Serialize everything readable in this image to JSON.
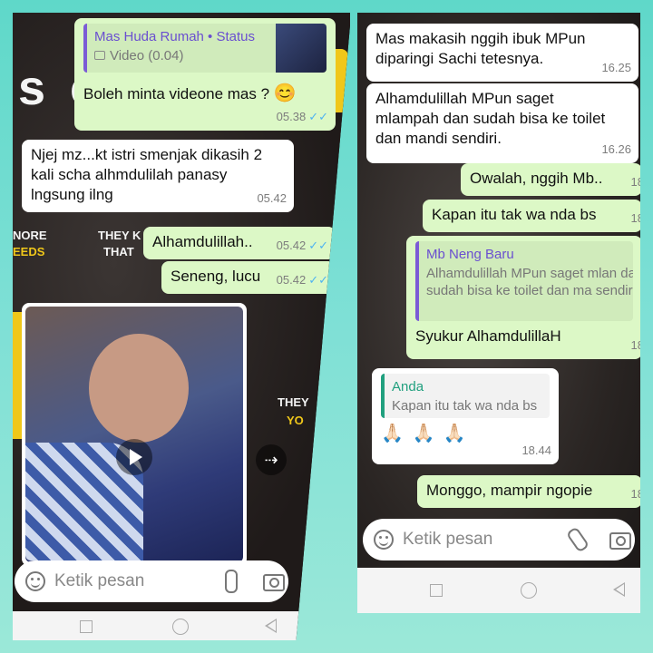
{
  "left": {
    "bg_text": {
      "top_big": "s c",
      "more": "NORE",
      "needs": "EEDS",
      "they1": "THEY K",
      "that": "THAT",
      "they2": "THEY",
      "you": "YO"
    },
    "msg1": {
      "reply_name": "Mas Huda Rumah • Status",
      "reply_text": "Video (0.04)",
      "text": "Boleh minta videone mas  ?",
      "emoji": "😊",
      "time": "05.38"
    },
    "msg2": {
      "text": "Njej mz...kt istri smenjak dikasih 2 kali scha alhmdulilah panasy lngsung ilng",
      "time": "05.42"
    },
    "msg3": {
      "text": "Alhamdulillah..",
      "time": "05.42"
    },
    "msg4": {
      "text": "Seneng, lucu",
      "time": "05.42"
    },
    "composer": {
      "placeholder": "Ketik pesan"
    }
  },
  "right": {
    "msg1": {
      "text": "Mas makasih nggih ibuk MPun diparingi Sachi tetesnya.",
      "time": "16.25"
    },
    "msg2": {
      "text": "Alhamdulillah MPun saget mlampah dan sudah bisa ke toilet dan mandi sendiri.",
      "time": "16.26"
    },
    "msg3": {
      "text": "Owalah, nggih Mb..",
      "time": "18"
    },
    "msg4": {
      "text": "Kapan itu tak wa nda bs",
      "time": "18"
    },
    "msg5": {
      "reply_name": "Mb Neng Baru",
      "reply_text": "Alhamdulillah MPun saget mlan dan sudah bisa ke toilet dan ma sendiri.",
      "text": "Syukur AlhamdulillaH",
      "time": "18"
    },
    "msg6": {
      "reply_name": "Anda",
      "reply_text": "Kapan itu tak wa nda bs",
      "emojis": "🙏🏻 🙏🏻 🙏🏻",
      "time": "18.44"
    },
    "msg7": {
      "text": "Monggo, mampir ngopie",
      "time": "18"
    },
    "composer": {
      "placeholder": "Ketik pesan"
    }
  },
  "colors": {
    "outgoing": "#dcf8c6",
    "incoming": "#ffffff",
    "tick": "#4fb3f1",
    "frame": "#7fe0d6"
  }
}
